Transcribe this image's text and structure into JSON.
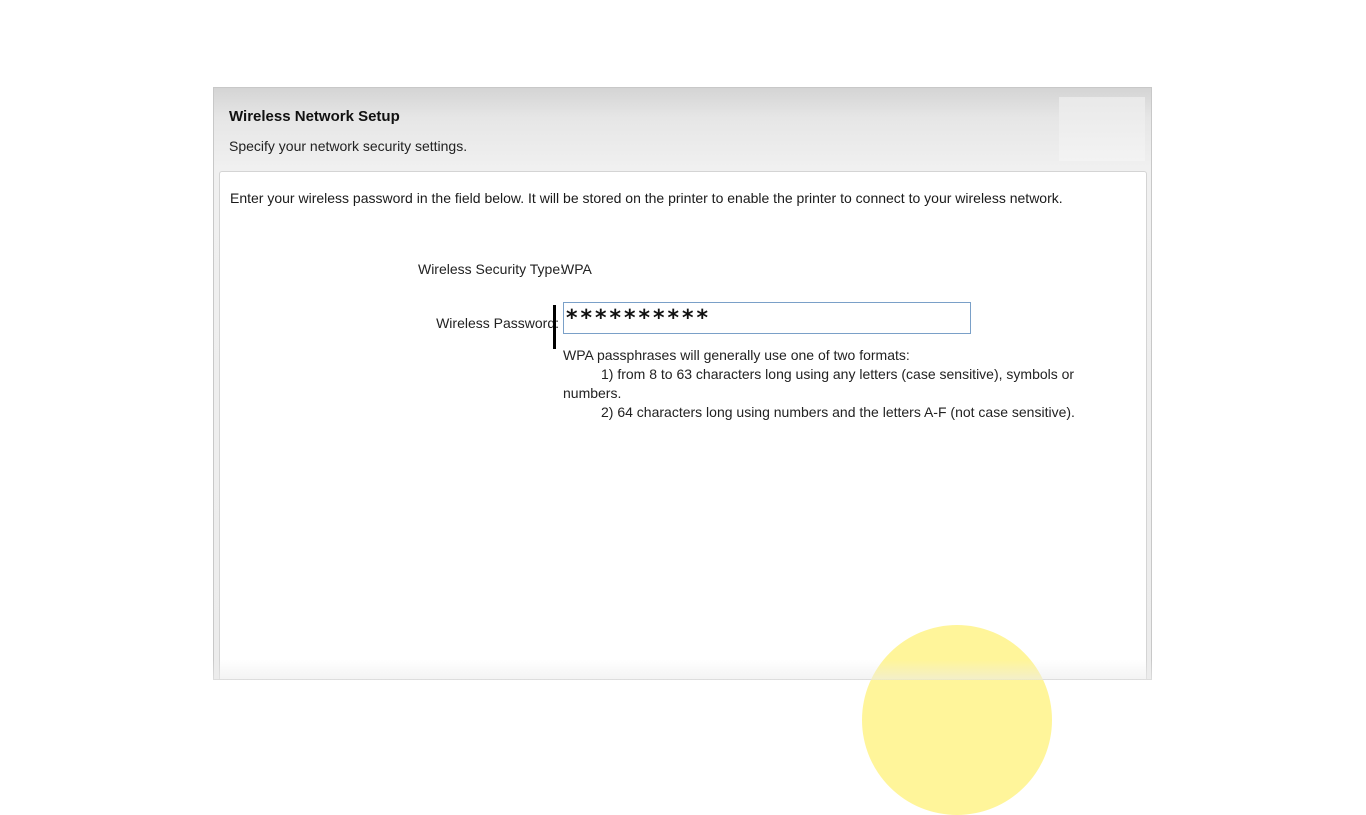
{
  "dialog": {
    "title": "Wireless Network Setup",
    "subtitle": "Specify your network security settings."
  },
  "content": {
    "instructions": "Enter your wireless password in the field below. It will be stored on the printer to enable the printer to connect to your wireless network.",
    "security_type_label": "Wireless Security Type:",
    "security_type_value": "WPA",
    "password_label": "Wireless Password:",
    "password_value": "**********",
    "hint_intro": "WPA passphrases will generally use one of two formats:",
    "hint_format_1": "1) from 8 to 63 characters long using any letters (case sensitive), symbols or",
    "hint_format_1_cont": "numbers.",
    "hint_format_2": "2) 64 characters long using numbers and the letters A-F (not case sensitive)."
  },
  "colors": {
    "highlight": "#fff178",
    "input_border": "#7aa0c8"
  }
}
